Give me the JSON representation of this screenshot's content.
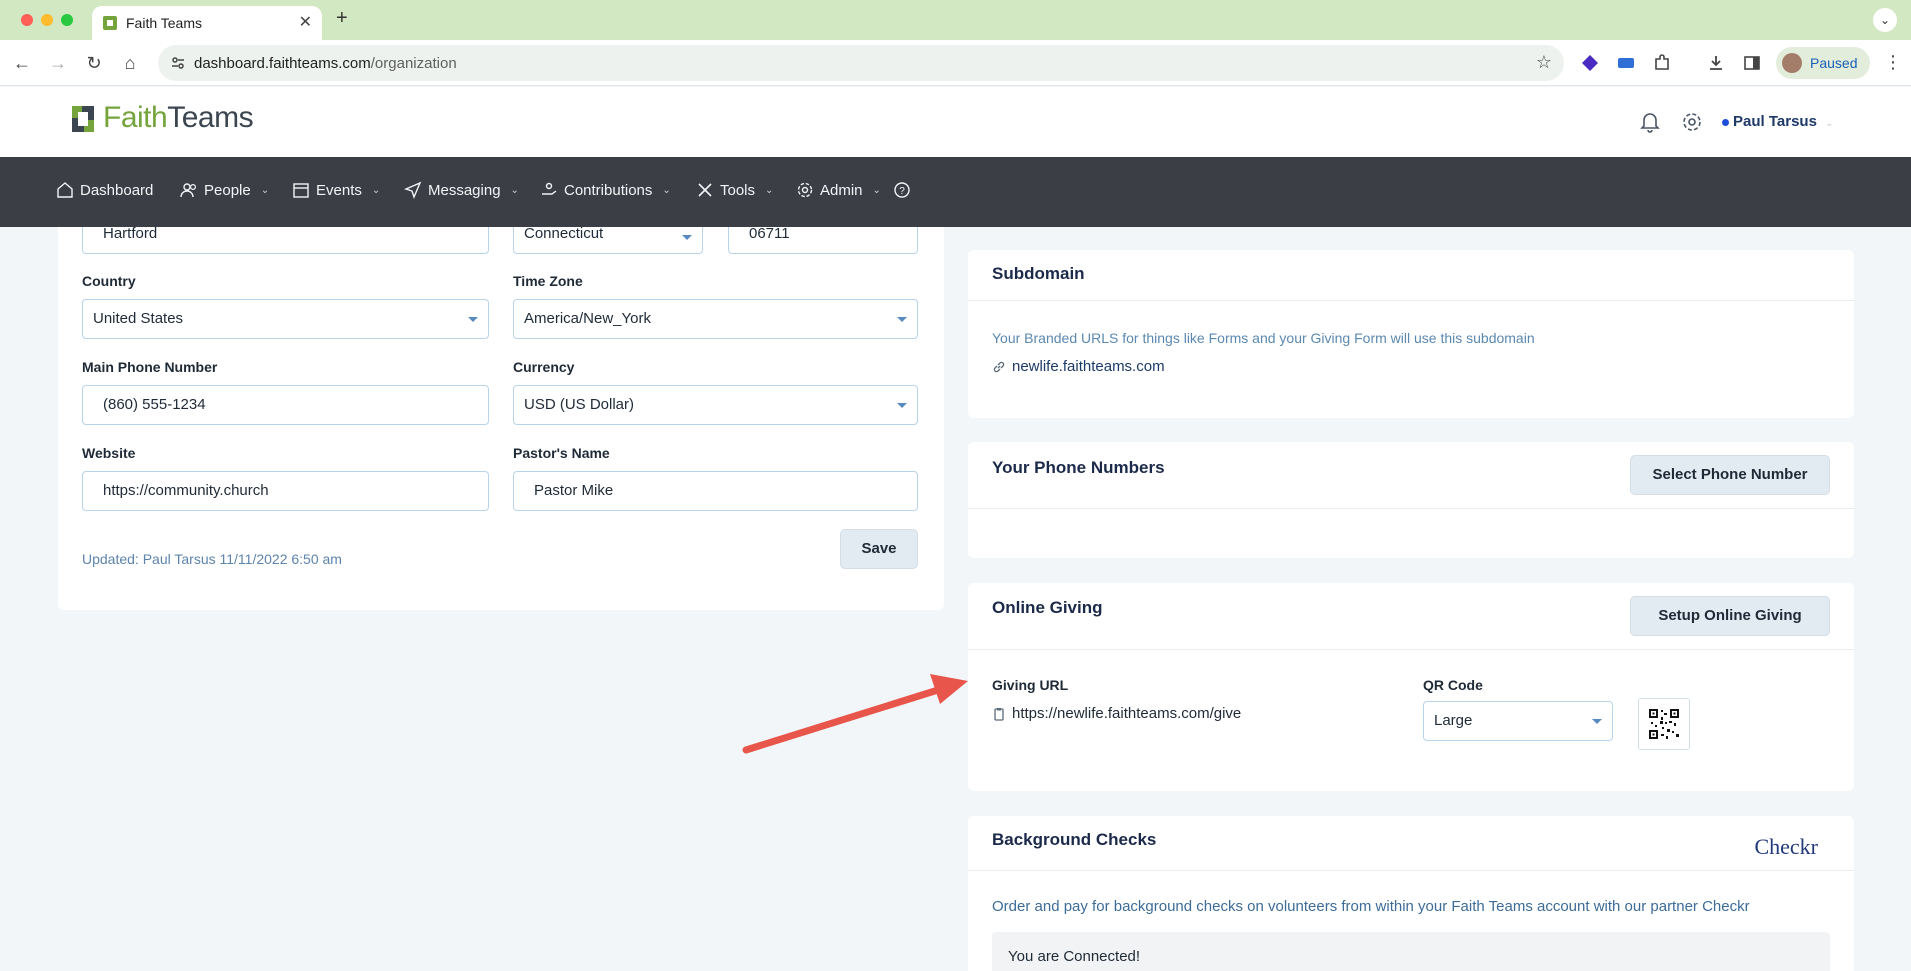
{
  "browser": {
    "tab_title": "Faith Teams",
    "url_host": "dashboard.faithteams.com",
    "url_path": "/organization",
    "profile_label": "Paused"
  },
  "app": {
    "logo_faith": "Faith",
    "logo_teams": "Teams",
    "user_name": "Paul Tarsus"
  },
  "nav": {
    "items": [
      {
        "label": "Dashboard",
        "icon": "home-icon"
      },
      {
        "label": "People",
        "icon": "people-icon"
      },
      {
        "label": "Events",
        "icon": "calendar-icon"
      },
      {
        "label": "Messaging",
        "icon": "send-icon"
      },
      {
        "label": "Contributions",
        "icon": "hand-coin-icon"
      },
      {
        "label": "Tools",
        "icon": "tools-icon"
      },
      {
        "label": "Admin",
        "icon": "gear-icon"
      }
    ]
  },
  "form": {
    "city_value": "Hartford",
    "state_value": "Connecticut",
    "zip_value": "06711",
    "country_label": "Country",
    "country_value": "United States",
    "timezone_label": "Time Zone",
    "timezone_value": "America/New_York",
    "phone_label": "Main Phone Number",
    "phone_value": "(860) 555-1234",
    "currency_label": "Currency",
    "currency_value": "USD (US Dollar)",
    "website_label": "Website",
    "website_value": "https://community.church",
    "pastor_label": "Pastor's Name",
    "pastor_value": "Pastor Mike",
    "updated_text": "Updated: Paul Tarsus 11/11/2022 6:50 am",
    "save_label": "Save"
  },
  "subdomain": {
    "title": "Subdomain",
    "description": "Your Branded URLS for things like Forms and your Giving Form will use this subdomain",
    "link": "newlife.faithteams.com"
  },
  "phone_numbers": {
    "title": "Your Phone Numbers",
    "button": "Select Phone Number"
  },
  "online_giving": {
    "title": "Online Giving",
    "button": "Setup Online Giving",
    "giving_url_label": "Giving URL",
    "giving_url": "https://newlife.faithteams.com/give",
    "qr_label": "QR Code",
    "qr_size": "Large"
  },
  "background_checks": {
    "title": "Background Checks",
    "partner_logo": "Checkr",
    "description": "Order and pay for background checks on volunteers from within your Faith Teams account with our partner Checkr",
    "status": "You are Connected!"
  },
  "colors": {
    "brand_green": "#74a43b",
    "navbar": "#3b3f45",
    "annotation_arrow": "#e8554a"
  }
}
